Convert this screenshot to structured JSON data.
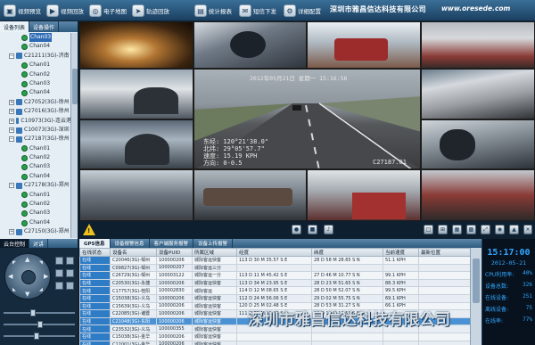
{
  "toolbar": {
    "buttons": [
      {
        "label": "视频预览",
        "icon": "video-preview-icon"
      },
      {
        "label": "视频回放",
        "icon": "video-playback-icon"
      },
      {
        "label": "电子地图",
        "icon": "map-icon"
      },
      {
        "label": "轨迹回放",
        "icon": "track-icon"
      },
      {
        "label": "统计报表",
        "icon": "report-icon"
      },
      {
        "label": "短信下发",
        "icon": "sms-icon"
      },
      {
        "label": "详细配置",
        "icon": "settings-icon"
      }
    ],
    "company": "深圳市雅昌信达科技有限公司",
    "url": "www.oresede.com"
  },
  "device_panel": {
    "tabs": [
      "设备列表",
      "设备操作"
    ],
    "tree": [
      {
        "type": "cam",
        "label": "Chan03",
        "selected": true
      },
      {
        "type": "cam",
        "label": "Chan04"
      },
      {
        "type": "dev",
        "label": "C21211(3G)-济南",
        "expanded": true
      },
      {
        "type": "cam",
        "label": "Chan01"
      },
      {
        "type": "cam",
        "label": "Chan02"
      },
      {
        "type": "cam",
        "label": "Chan03"
      },
      {
        "type": "cam",
        "label": "Chan04"
      },
      {
        "type": "dev",
        "label": "C27052(3G)-徐州"
      },
      {
        "type": "dev",
        "label": "C27016(3G)-徐州"
      },
      {
        "type": "dev",
        "label": "C10973(3G)-连云港"
      },
      {
        "type": "dev",
        "label": "C10073(3G)-深圳"
      },
      {
        "type": "dev",
        "label": "C27187(3G)-徐州",
        "expanded": true
      },
      {
        "type": "cam",
        "label": "Chan01"
      },
      {
        "type": "cam",
        "label": "Chan02"
      },
      {
        "type": "cam",
        "label": "Chan03"
      },
      {
        "type": "cam",
        "label": "Chan04"
      },
      {
        "type": "dev",
        "label": "C27178(3G)-郑州",
        "expanded": true
      },
      {
        "type": "cam",
        "label": "Chan01"
      },
      {
        "type": "cam",
        "label": "Chan02"
      },
      {
        "type": "cam",
        "label": "Chan03"
      },
      {
        "type": "cam",
        "label": "Chan04"
      },
      {
        "type": "dev",
        "label": "C27150(3G)-郑州"
      }
    ]
  },
  "video": {
    "main": {
      "time": "2012年05月21日  星期一  15:16:56",
      "lon": "东经: 120°21'38.0\"",
      "lat": "北纬: 29°05'57.7\"",
      "speed": "速度: 15.19 KPH",
      "dir": "方向: 0-0.5",
      "id": "C27187.01"
    }
  },
  "ptz_panel": {
    "tabs": [
      "云台控制",
      "对讲"
    ]
  },
  "gps_panel": {
    "tabs": [
      "GPS信息",
      "设备报警信息",
      "客户端服务报警",
      "设备上传报警"
    ],
    "columns": [
      "在线状态",
      "设备名",
      "设备PUID",
      "所属区域",
      "经度",
      "纬度",
      "当前速度",
      "最新位置"
    ],
    "rows": [
      [
        "在线",
        "C20046(3G)-邹州",
        "100000206",
        "城际客运快客",
        "113 D 30 M 35.57 S E",
        "28 D 58 M 28.65 S N",
        "51.1 KPH",
        ""
      ],
      [
        "在线",
        "C09827(3G)-邹州",
        "100000207",
        "城际客运三分",
        "",
        "",
        "",
        ""
      ],
      [
        "在线",
        "C26729(3G)-邹州",
        "100003122",
        "城际客运一分",
        "113 D 11 M 45.42 S E",
        "27 D 46 M 10.77 S N",
        "99.1 KPH",
        ""
      ],
      [
        "在线",
        "C20530(3G)-永捷",
        "100000206",
        "城际客运快客",
        "113 D 34 M 23.95 S E",
        "28 D 23 M 51.65 S N",
        "88.3 KPH",
        ""
      ],
      [
        "在线",
        "C17757(3G)-桂阳",
        "100002830",
        "城际客运",
        "114 D 12 M 08.65 S E",
        "28 D 50 M 52.07 S N",
        "99.5 KPH",
        ""
      ],
      [
        "在线",
        "C15038(3G)-义乌",
        "100000206",
        "城际客运快客",
        "112 D 24 M 56.06 S E",
        "29 D 02 M 55.75 S N",
        "69.1 KPH",
        ""
      ],
      [
        "在线",
        "C15639(3G)-义乌",
        "100000206",
        "城际客运快客",
        "120 D 25 M 02.48 S E",
        "28 D 53 M 31.27 S N",
        "66.1 KPH",
        ""
      ],
      [
        "在线",
        "C22085(3G)-诸暨",
        "100000206",
        "城际客运快客",
        "111 D 31 M 13.43 S E",
        "28 D 12 M 12.53 S N",
        "",
        ""
      ],
      [
        "在线",
        "C21048(3G)-东阳",
        "100000206",
        "城际客运快客",
        "",
        "",
        "",
        ""
      ],
      [
        "在线",
        "C23532(3G)-义乌",
        "100000355",
        "城际客运快客",
        "",
        "",
        "",
        ""
      ],
      [
        "在线",
        "C15038(3G)-金华",
        "100000206",
        "城际客运快客",
        "",
        "",
        "",
        ""
      ],
      [
        "在线",
        "C12001(3G)-金华",
        "100000206",
        "城际客运快客",
        "",
        "",
        "",
        ""
      ]
    ]
  },
  "status_panel": {
    "time": "15:17:00",
    "date": "2012-05-21",
    "stats": [
      {
        "label": "CPU利用率:",
        "value": "40%"
      },
      {
        "label": "设备总数:",
        "value": "326"
      },
      {
        "label": "在线设备:",
        "value": "251"
      },
      {
        "label": "离线设备:",
        "value": "75"
      },
      {
        "label": "在线率:",
        "value": "77%"
      }
    ]
  },
  "watermark": "深圳市雅昌信达科技有限公司",
  "colors": {
    "toolbar": "#2a5a82",
    "accent": "#33a6ff",
    "warning": "#f1c21b"
  }
}
